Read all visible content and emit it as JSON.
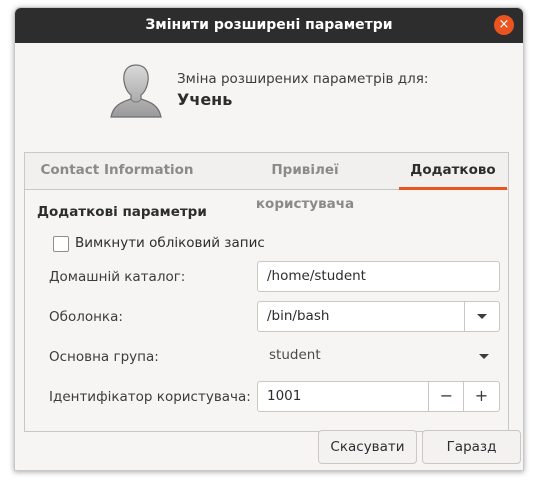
{
  "dialog": {
    "title": "Змінити розширені параметри",
    "close_icon": "×"
  },
  "header": {
    "subtitle": "Зміна розширених параметрів для:",
    "user_name": "Учень"
  },
  "tabs": [
    {
      "label": "Contact Information",
      "active": false
    },
    {
      "label": "Привілеї користувача",
      "active": false
    },
    {
      "label": "Додатково",
      "active": true
    }
  ],
  "advanced": {
    "section_title": "Додаткові параметри",
    "disable_account": {
      "label": "Вимкнути обліковий запис",
      "checked": false
    },
    "home": {
      "label": "Домашній каталог:",
      "value": "/home/student"
    },
    "shell": {
      "label": "Оболонка:",
      "value": "/bin/bash"
    },
    "group": {
      "label": "Основна група:",
      "value": "student"
    },
    "uid": {
      "label": "Ідентифікатор користувача:",
      "value": "1001",
      "minus": "−",
      "plus": "+"
    }
  },
  "buttons": {
    "cancel": "Скасувати",
    "ok": "Гаразд"
  },
  "colors": {
    "accent": "#e95420",
    "titlebar": "#2d2d2d",
    "background": "#f6f5f4"
  }
}
